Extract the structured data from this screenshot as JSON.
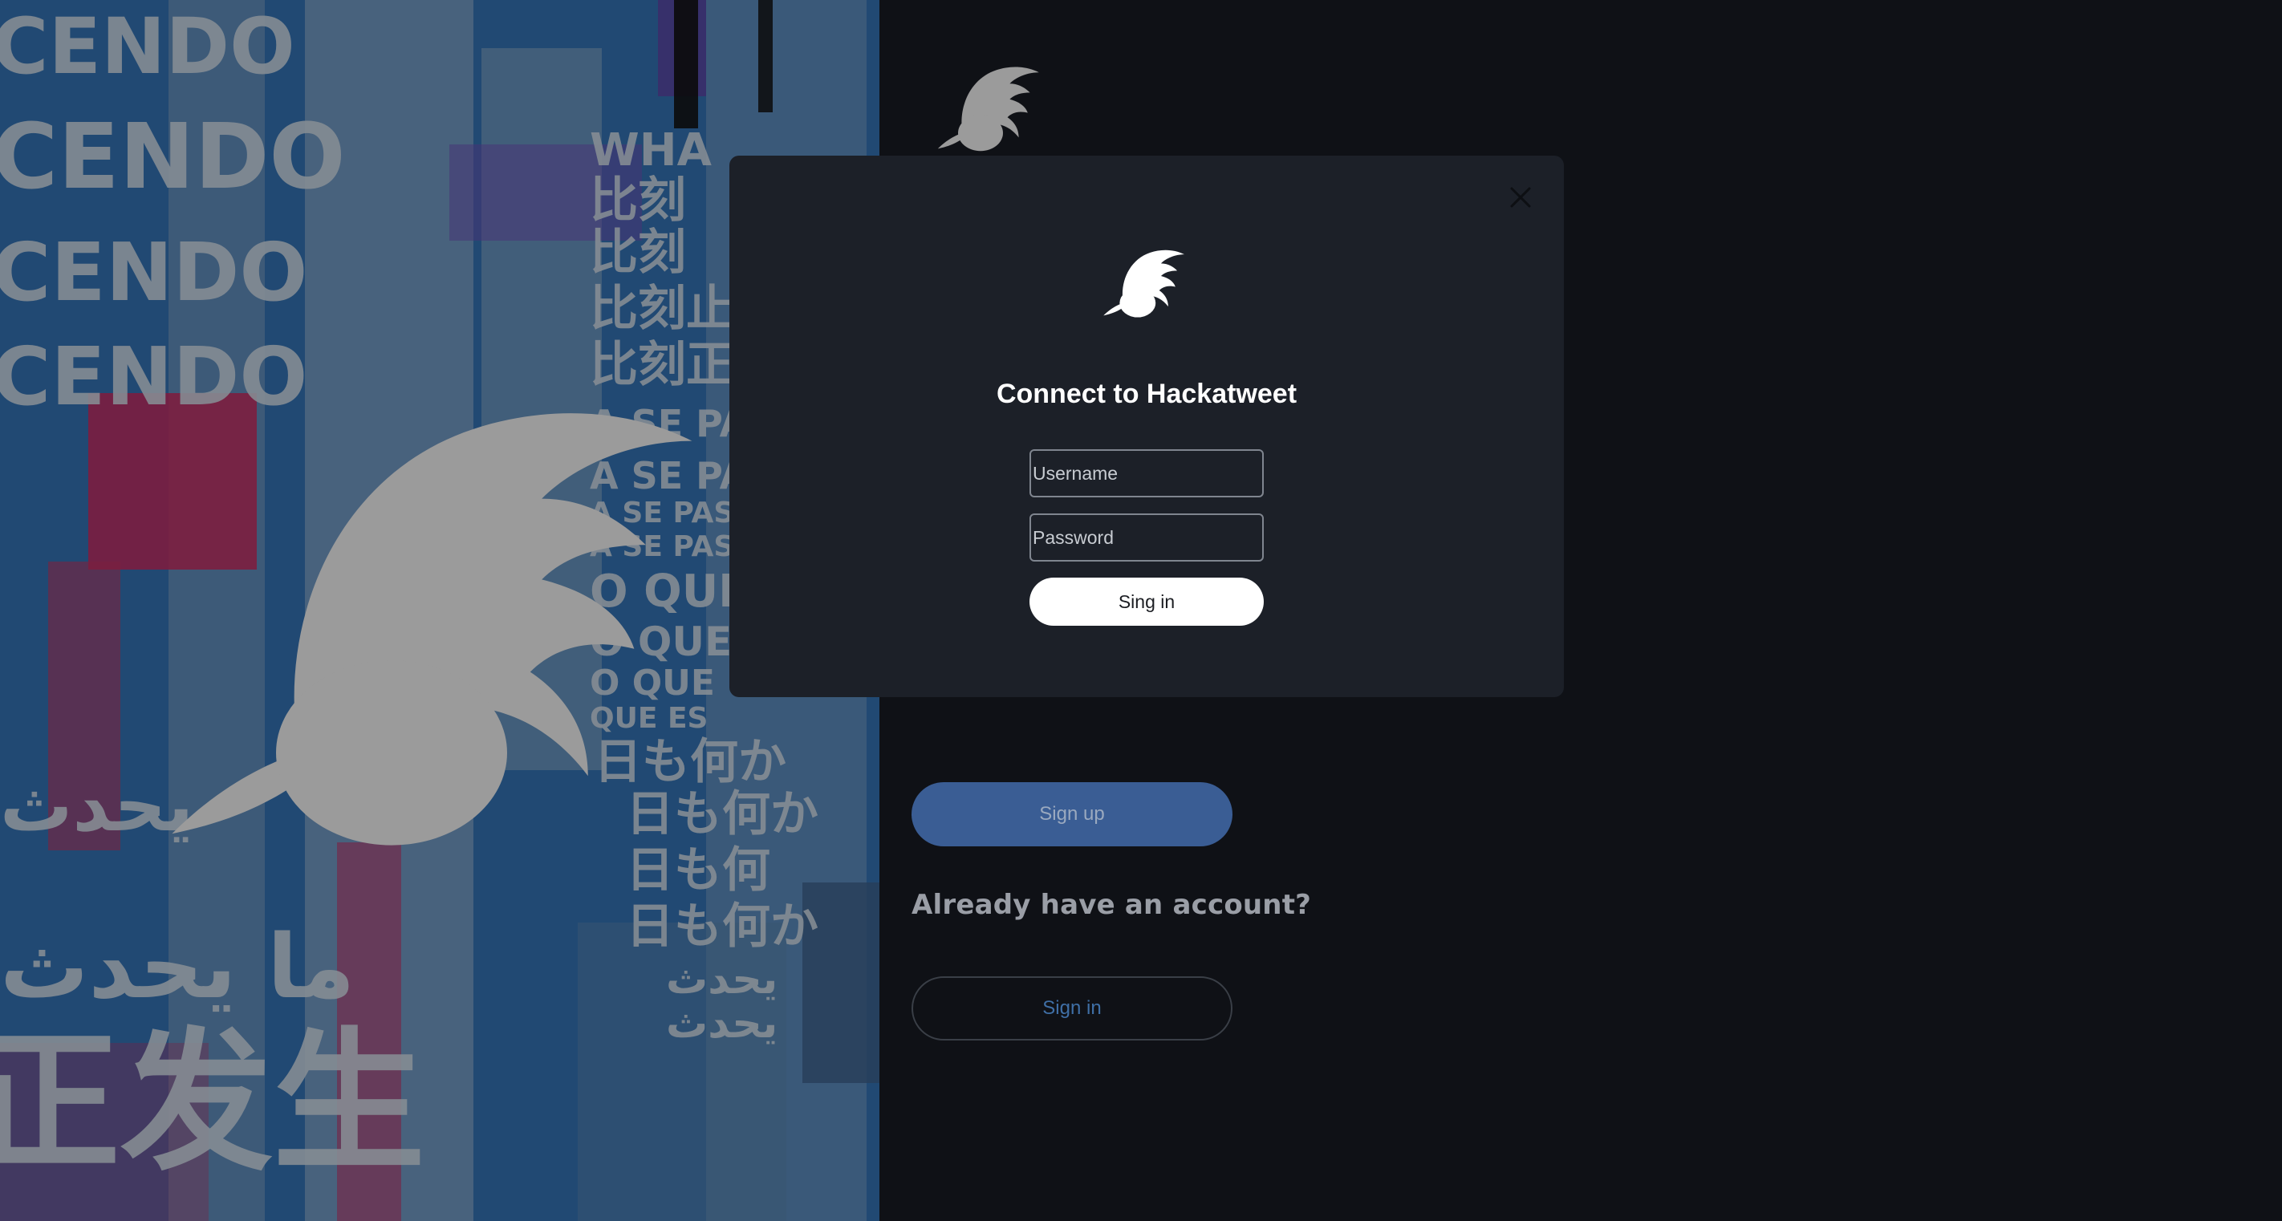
{
  "app": {
    "name": "Hackatweet"
  },
  "hero": {
    "poster_lines": [
      "CENDO",
      "CENDO",
      "CENDO",
      "CENDO",
      "WHA",
      "比刻",
      "比刻",
      "比刻止",
      "比刻正",
      "A SE PAS",
      "A SE PAS",
      "A SE PAS",
      "A SE PAS",
      "O QUE",
      "O QUE",
      "O QUE",
      "QUE ES",
      "日も何か",
      "日も何か",
      "日も何",
      "日も何か",
      "يحدث",
      "يحدث",
      "يحدث",
      "ما يحدث",
      "正发生"
    ]
  },
  "landing": {
    "signup_label": "Sign up",
    "already_text": "Already have an account?",
    "signin_label": "Sign in"
  },
  "modal": {
    "title": "Connect to Hackatweet",
    "username_placeholder": "Username",
    "password_placeholder": "Password",
    "submit_label": "Sing in",
    "close_icon": "close-icon"
  },
  "colors": {
    "page_background": "#0f1116",
    "modal_background": "#1c2028",
    "signup_button": "#3a5d94",
    "signin_link": "#3f6fa6",
    "logo_gray": "#9b9b9b",
    "logo_white": "#ffffff"
  }
}
